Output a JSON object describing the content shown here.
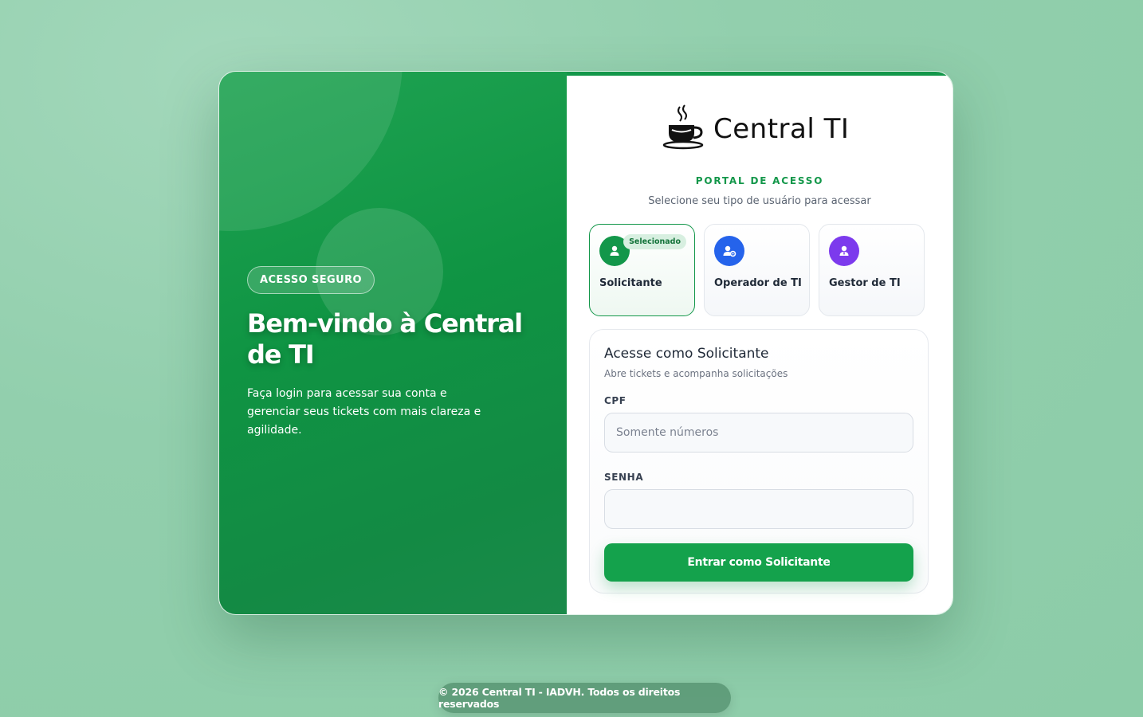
{
  "hero": {
    "badge": "ACESSO SEGURO",
    "title": "Bem-vindo à Central de TI",
    "subtitle": "Faça login para acessar sua conta e gerenciar seus tickets com mais clareza e agilidade."
  },
  "brand": {
    "name": "Central TI",
    "logo_icon": "coffee-cup-icon"
  },
  "portal": {
    "heading": "PORTAL DE ACESSO",
    "subheading": "Selecione seu tipo de usuário para acessar"
  },
  "user_types": [
    {
      "label": "Solicitante",
      "icon": "user-icon",
      "color": "#13974a",
      "selected": true,
      "badge": "Selecionado"
    },
    {
      "label": "Operador de TI",
      "icon": "user-gear-icon",
      "color": "#2563eb",
      "selected": false
    },
    {
      "label": "Gestor de TI",
      "icon": "user-tie-icon",
      "color": "#7c3aed",
      "selected": false
    }
  ],
  "form": {
    "title": "Acesse como Solicitante",
    "subtitle": "Abre tickets e acompanha solicitações",
    "cpf_label": "CPF",
    "cpf_placeholder": "Somente números",
    "cpf_value": "",
    "password_label": "SENHA",
    "password_value": "",
    "submit_label": "Entrar como Solicitante"
  },
  "footer": {
    "text": "© 2026 Central TI - IADVH. Todos os direitos reservados"
  },
  "colors": {
    "accent": "#13974a",
    "operator": "#2563eb",
    "manager": "#7c3aed"
  }
}
